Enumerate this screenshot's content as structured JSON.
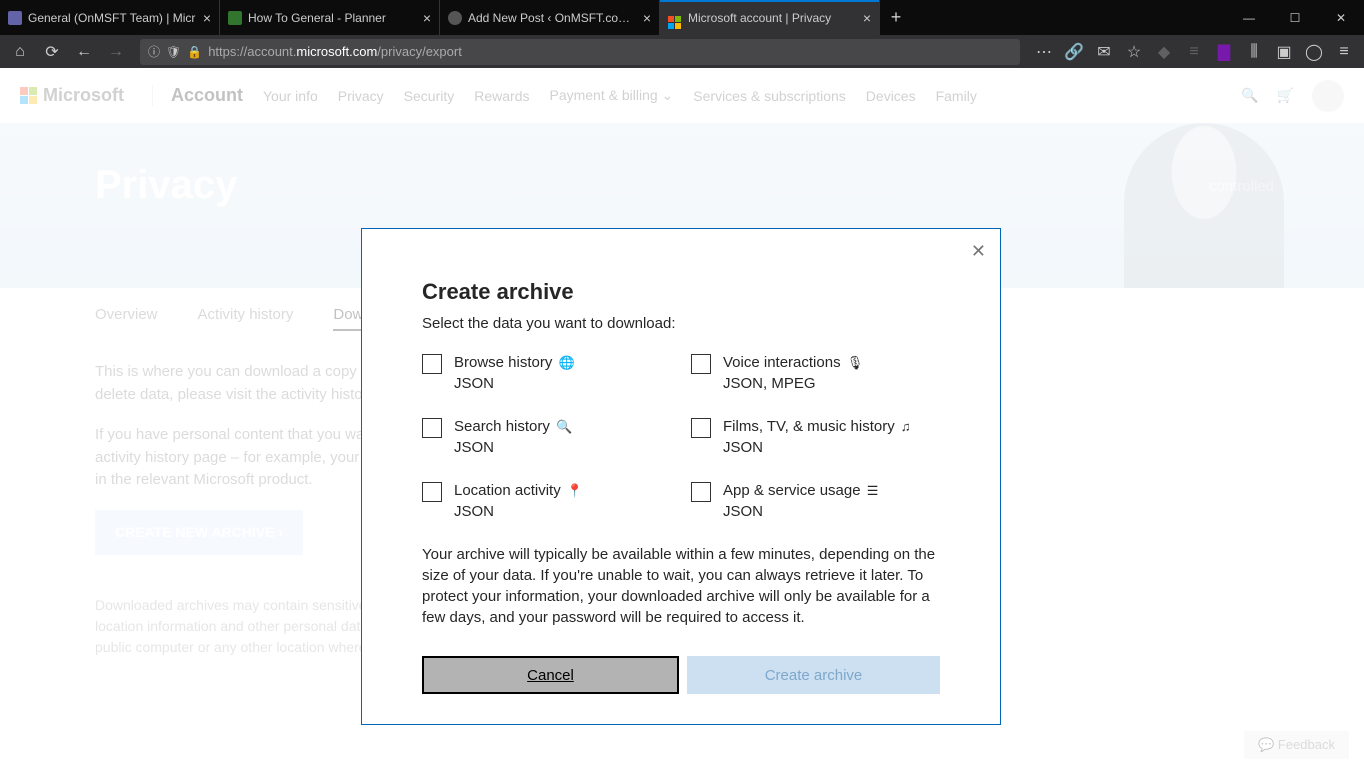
{
  "browser": {
    "tabs": [
      {
        "title": "General (OnMSFT Team) | Micr"
      },
      {
        "title": "How To General - Planner"
      },
      {
        "title": "Add New Post ‹ OnMSFT.com — W"
      },
      {
        "title": "Microsoft account | Privacy"
      }
    ],
    "url_proto": "https://",
    "url_prefix": "account.",
    "url_domain": "microsoft.com",
    "url_path": "/privacy/export"
  },
  "header": {
    "brand": "Microsoft",
    "section": "Account",
    "nav": [
      "Your info",
      "Privacy",
      "Security",
      "Rewards",
      "Payment & billing",
      "Services & subscriptions",
      "Devices",
      "Family"
    ]
  },
  "hero": {
    "title": "Privacy",
    "tag": "controlled"
  },
  "page_tabs": [
    "Overview",
    "Activity history",
    "Dow"
  ],
  "body": {
    "p1": "This is where you can download a copy of the data shown in your activity history. To delete data, please visit the activity history page.",
    "p2": "If you have personal content that you want to download that's not shown on the activity history page – for example, your email, calendar and photos – you can find it in the relevant Microsoft product.",
    "cta": "CREATE NEW ARCHIVE  ›",
    "footer": "Downloaded archives may contain sensitive content, such as your search history, location information and other personal data. Do not download your archive to a public computer or any other location where others might be able to access it."
  },
  "feedback": "Feedback",
  "modal": {
    "title": "Create archive",
    "subtitle": "Select the data you want to download:",
    "options": [
      {
        "name": "Browse history",
        "icon": "🌐",
        "format": "JSON"
      },
      {
        "name": "Voice interactions",
        "icon": "🎙",
        "format": "JSON, MPEG"
      },
      {
        "name": "Search history",
        "icon": "🔍",
        "format": "JSON"
      },
      {
        "name": "Films, TV, & music history",
        "icon": "♫",
        "format": "JSON"
      },
      {
        "name": "Location activity",
        "icon": "📍",
        "format": "JSON"
      },
      {
        "name": "App & service usage",
        "icon": "☰",
        "format": "JSON"
      }
    ],
    "description": "Your archive will typically be available within a few minutes, depending on the size of your data. If you're unable to wait, you can always retrieve it later. To protect your information, your downloaded archive will only be available for a few days, and your password will be required to access it.",
    "cancel": "Cancel",
    "create": "Create archive"
  }
}
